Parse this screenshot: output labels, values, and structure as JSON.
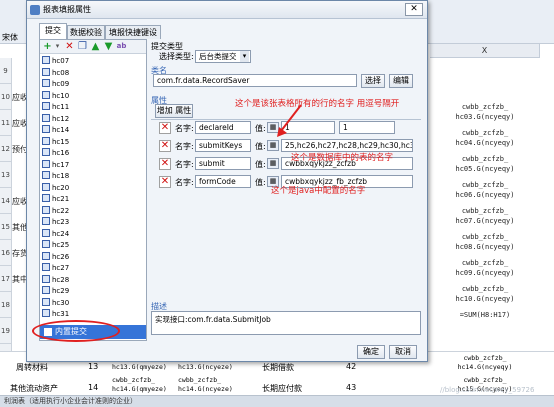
{
  "spreadsheet": {
    "left_rows": [
      {
        "num": "9",
        "text": ""
      },
      {
        "num": "10",
        "text": "应收利"
      },
      {
        "num": "11",
        "text": "应收账"
      },
      {
        "num": "12",
        "text": "预付账"
      },
      {
        "num": "13",
        "text": ""
      },
      {
        "num": "14",
        "text": "应收补"
      },
      {
        "num": "15",
        "text": "其他应"
      },
      {
        "num": "16",
        "text": "存货"
      },
      {
        "num": "17",
        "text": "其中"
      },
      {
        "num": "18",
        "text": ""
      },
      {
        "num": "19",
        "text": ""
      },
      {
        "num": "20",
        "text": "周转材料"
      },
      {
        "num": "21",
        "text": "其他流动资产"
      }
    ],
    "column_header_x": "X",
    "right_cells": [
      "cwbb_zcfzb_\nhc03.G(ncyeqy)",
      "cwbb_zcfzb_\nhc04.G(ncyeqy)",
      "cwbb_zcfzb_\nhc05.G(ncyeqy)",
      "cwbb_zcfzb_\nhc06.G(ncyeqy)",
      "cwbb_zcfzb_\nhc07.G(ncyeqy)",
      "cwbb_zcfzb_\nhc08.G(ncyeqy)",
      "cwbb_zcfzb_\nhc09.G(ncyeqy)",
      "cwbb_zcfzb_\nhc10.G(ncyeqy)",
      "=SUM(H8:H17)"
    ],
    "bottom_row1": {
      "label": "周转材料",
      "num": "13",
      "c1": "cwbb_zcfzb_\nhc13.G(qmyeze)",
      "c2": "cwbb_zcfzb_\nhc13.G(ncyeze)",
      "desc": "长期借款",
      "n2": "42",
      "c3": "cwbb_zcfzb_\nhc14.G(ncyeqy)"
    },
    "bottom_row2": {
      "label": "其他流动资产",
      "num": "14",
      "c1": "cwbb_zcfzb_\nhc14.G(qmyeze)",
      "c2": "cwbb_zcfzb_\nhc14.G(ncyeze)",
      "desc": "长期应付款",
      "n2": "43",
      "c3": "cwbb_zcfzb_\nhc15.G(ncyeqy)"
    },
    "status_text": "利润表（适用执行小企业会计准则的企业）",
    "toolbar_font": "宋体",
    "watermark": "//blog.csdn.net/wey_59726"
  },
  "dialog": {
    "title": "报表填报属性",
    "close_label": "✕",
    "tabs": [
      "提交",
      "数据校验",
      "填报快捷键设置"
    ],
    "tree_items": [
      "hc07",
      "hc08",
      "hc09",
      "hc10",
      "hc11",
      "hc12",
      "hc14",
      "hc15",
      "hc16",
      "hc17",
      "hc18",
      "hc20",
      "hc21",
      "hc22",
      "hc23",
      "hc24",
      "hc25",
      "hc26",
      "hc27",
      "hc28",
      "hc29",
      "hc30",
      "hc31"
    ],
    "tree_selected": "内置提交",
    "submit_type_header": "提交类型",
    "choose_type_label": "选择类型:",
    "choose_type_value": "后台类提交",
    "class_name_header": "类名",
    "class_name_value": "com.fr.data.RecordSaver",
    "choose_button": "选择",
    "edit_button": "编辑",
    "properties_header": "属性",
    "add_property_button": "增加 属性",
    "property_rows": [
      {
        "name_label": "名字:",
        "name": "declareId",
        "value_label": "值:",
        "value": "1",
        "value2": "1"
      },
      {
        "name_label": "名字:",
        "name": "submitKeys",
        "value_label": "值:",
        "value": "25,hc26,hc27,hc28,hc29,hc30,hc31"
      },
      {
        "name_label": "名字:",
        "name": "submit",
        "value_label": "值:",
        "value": "cwbbxqykjzz_zcfzb"
      },
      {
        "name_label": "名字:",
        "name": "formCode",
        "value_label": "值:",
        "value": "cwbbxqykjzz_fb_zcfzb"
      }
    ],
    "annotations": {
      "a1": "这个是该张表格所有的行的名字 用逗号隔开",
      "a2": "这个是数据库中的表的名字",
      "a3": "这个是java中配置的名字"
    },
    "description_header": "描述",
    "description_text": "实现接口:com.fr.data.SubmitJob",
    "ok_button": "确定",
    "cancel_button": "取消"
  },
  "colors": {
    "annotation": "#e02020",
    "accent": "#3464b4"
  }
}
